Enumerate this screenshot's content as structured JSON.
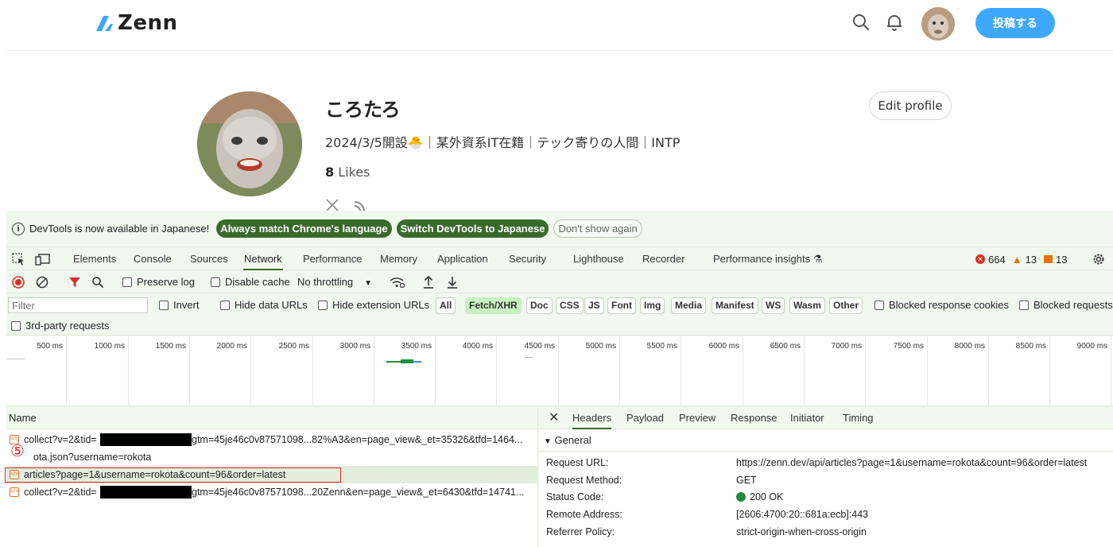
{
  "zenn": {
    "logo_text": "Zenn",
    "post_button": "投稿する",
    "brand_color": "#3ea8ff"
  },
  "profile": {
    "name": "ころたろ",
    "bio": "2024/3/5開設🐣｜某外資系IT在籍｜テック寄りの人間｜INTP",
    "likes_count": "8",
    "likes_label": "Likes",
    "edit_button": "Edit profile"
  },
  "devtools": {
    "infobar": {
      "message": "DevTools is now available in Japanese!",
      "btn_match": "Always match Chrome's language",
      "btn_switch": "Switch DevTools to Japanese",
      "btn_dismiss": "Don't show again"
    },
    "tabs": [
      "Elements",
      "Console",
      "Sources",
      "Network",
      "Performance",
      "Memory",
      "Application",
      "Security",
      "Lighthouse",
      "Recorder",
      "Performance insights"
    ],
    "active_tab": "Network",
    "counters": {
      "errors": "664",
      "warnings": "13",
      "issues": "13"
    },
    "toolbar": {
      "preserve_log": "Preserve log",
      "disable_cache": "Disable cache",
      "throttling": "No throttling"
    },
    "filter": {
      "placeholder": "Filter",
      "invert": "Invert",
      "hide_data_urls": "Hide data URLs",
      "hide_ext_urls": "Hide extension URLs",
      "types": [
        "All",
        "Fetch/XHR",
        "Doc",
        "CSS",
        "JS",
        "Font",
        "Img",
        "Media",
        "Manifest",
        "WS",
        "Wasm",
        "Other"
      ],
      "selected_type": "Fetch/XHR",
      "blocked_cookies": "Blocked response cookies",
      "blocked_requests": "Blocked requests",
      "third_party": "3rd-party requests"
    },
    "timeline_ticks": [
      "500 ms",
      "1000 ms",
      "1500 ms",
      "2000 ms",
      "2500 ms",
      "3000 ms",
      "3500 ms",
      "4000 ms",
      "4500 ms",
      "5000 ms",
      "5500 ms",
      "6000 ms",
      "6500 ms",
      "7000 ms",
      "7500 ms",
      "8000 ms",
      "8500 ms",
      "9000 ms"
    ],
    "requests": {
      "header": "Name",
      "step_marker": "⑤",
      "rows": [
        {
          "pre": "collect?v=2&tid=",
          "post": "gtm=45je46c0v87571098...82%A3&en=page_view&_et=35326&tfd=1464..."
        },
        {
          "pre": "",
          "post": "ota.json?username=rokota"
        },
        {
          "pre": "articles?page=1&username=rokota&count=96&order=latest",
          "post": ""
        },
        {
          "pre": "collect?v=2&tid=",
          "post": "gtm=45je46c0v87571098...20Zenn&en=page_view&_et=6430&tfd=14741..."
        }
      ]
    },
    "details": {
      "tabs": [
        "Headers",
        "Payload",
        "Preview",
        "Response",
        "Initiator",
        "Timing"
      ],
      "active_tab": "Headers",
      "section": "General",
      "fields": [
        {
          "key": "Request URL:",
          "value": "https://zenn.dev/api/articles?page=1&username=rokota&count=96&order=latest"
        },
        {
          "key": "Request Method:",
          "value": "GET"
        },
        {
          "key": "Status Code:",
          "value": "200 OK"
        },
        {
          "key": "Remote Address:",
          "value": "[2606:4700:20::681a:ecb]:443"
        },
        {
          "key": "Referrer Policy:",
          "value": "strict-origin-when-cross-origin"
        }
      ]
    }
  }
}
